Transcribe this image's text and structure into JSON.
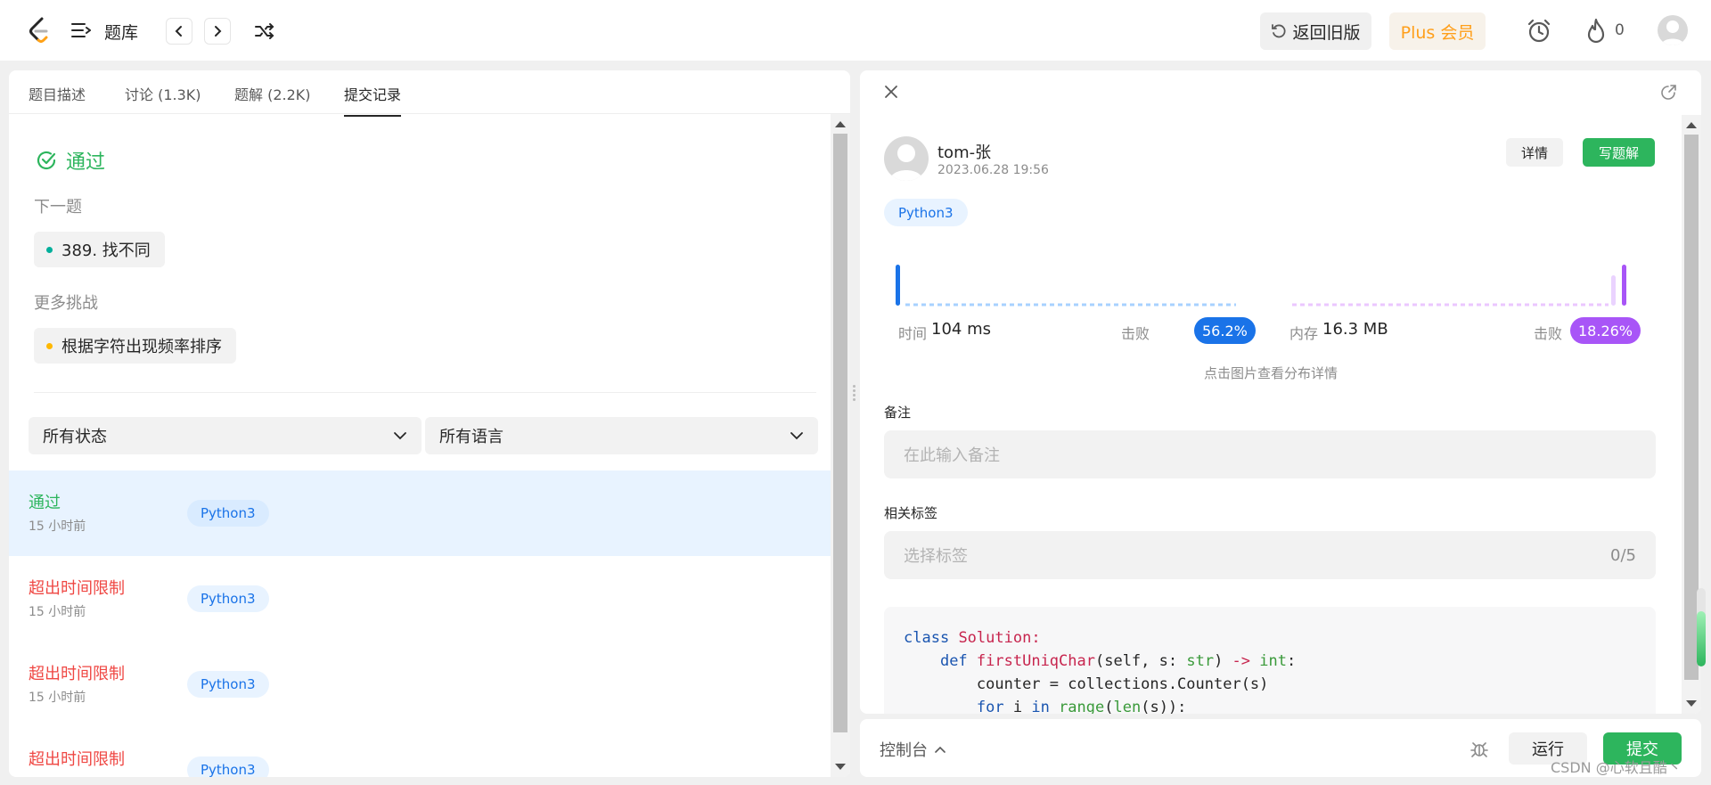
{
  "topbar": {
    "title": "题库",
    "back_old_label": "返回旧版",
    "plus_label": "Plus 会员",
    "fire_count": "0"
  },
  "left": {
    "tabs": [
      {
        "label": "题目描述"
      },
      {
        "label": "讨论 (1.3K)"
      },
      {
        "label": "题解 (2.2K)"
      },
      {
        "label": "提交记录"
      }
    ],
    "pass_text": "通过",
    "next_label": "下一题",
    "next_problem": "389. 找不同",
    "more_label": "更多挑战",
    "more_problem": "根据字符出现频率排序",
    "filter_status": "所有状态",
    "filter_lang": "所有语言",
    "submissions": [
      {
        "status": "通过",
        "time": "15 小时前",
        "lang": "Python3"
      },
      {
        "status": "超出时间限制",
        "time": "15 小时前",
        "lang": "Python3"
      },
      {
        "status": "超出时间限制",
        "time": "15 小时前",
        "lang": "Python3"
      },
      {
        "status": "超出时间限制",
        "time": "",
        "lang": "Python3"
      }
    ]
  },
  "right": {
    "username": "tom-张",
    "submit_time": "2023.06.28 19:56",
    "detail_label": "详情",
    "write_label": "写题解",
    "language": "Python3",
    "runtime": {
      "label": "时间",
      "value": "104 ms",
      "beat_label": "击败",
      "beat": "56.2%"
    },
    "memory": {
      "label": "内存",
      "value": "16.3 MB",
      "beat_label": "击败",
      "beat": "18.26%"
    },
    "hint": "点击图片查看分布详情",
    "note_label": "备注",
    "note_placeholder": "在此输入备注",
    "tags_label": "相关标签",
    "tags_placeholder": "选择标签",
    "tags_count": "0/5",
    "code": {
      "l1_kw": "class",
      "l1_name": "Solution",
      "l1_rest": ":",
      "l2_kw": "def",
      "l2_name": "firstUniqChar",
      "l2_a": "(self, s: ",
      "l2_t1": "str",
      "l2_b": ") ",
      "l2_arrow": "->",
      "l2_c": " ",
      "l2_t2": "int",
      "l2_d": ":",
      "l3": "counter = collections.Counter(s)",
      "l4_kw": "for",
      "l4_a": " i ",
      "l4_in": "in",
      "l4_b": " ",
      "l4_range": "range",
      "l4_c": "(",
      "l4_len": "len",
      "l4_d": "(s)):"
    }
  },
  "console": {
    "label": "控制台",
    "run_label": "运行",
    "submit_label": "提交"
  },
  "watermark": "CSDN @心软且酷丶",
  "colors": {
    "accent_green": "#2db55d",
    "error_red": "#ef4743",
    "runtime_blue": "#1a73e8",
    "memory_purple": "#a855f7",
    "plus_orange": "#ff9f1a"
  }
}
